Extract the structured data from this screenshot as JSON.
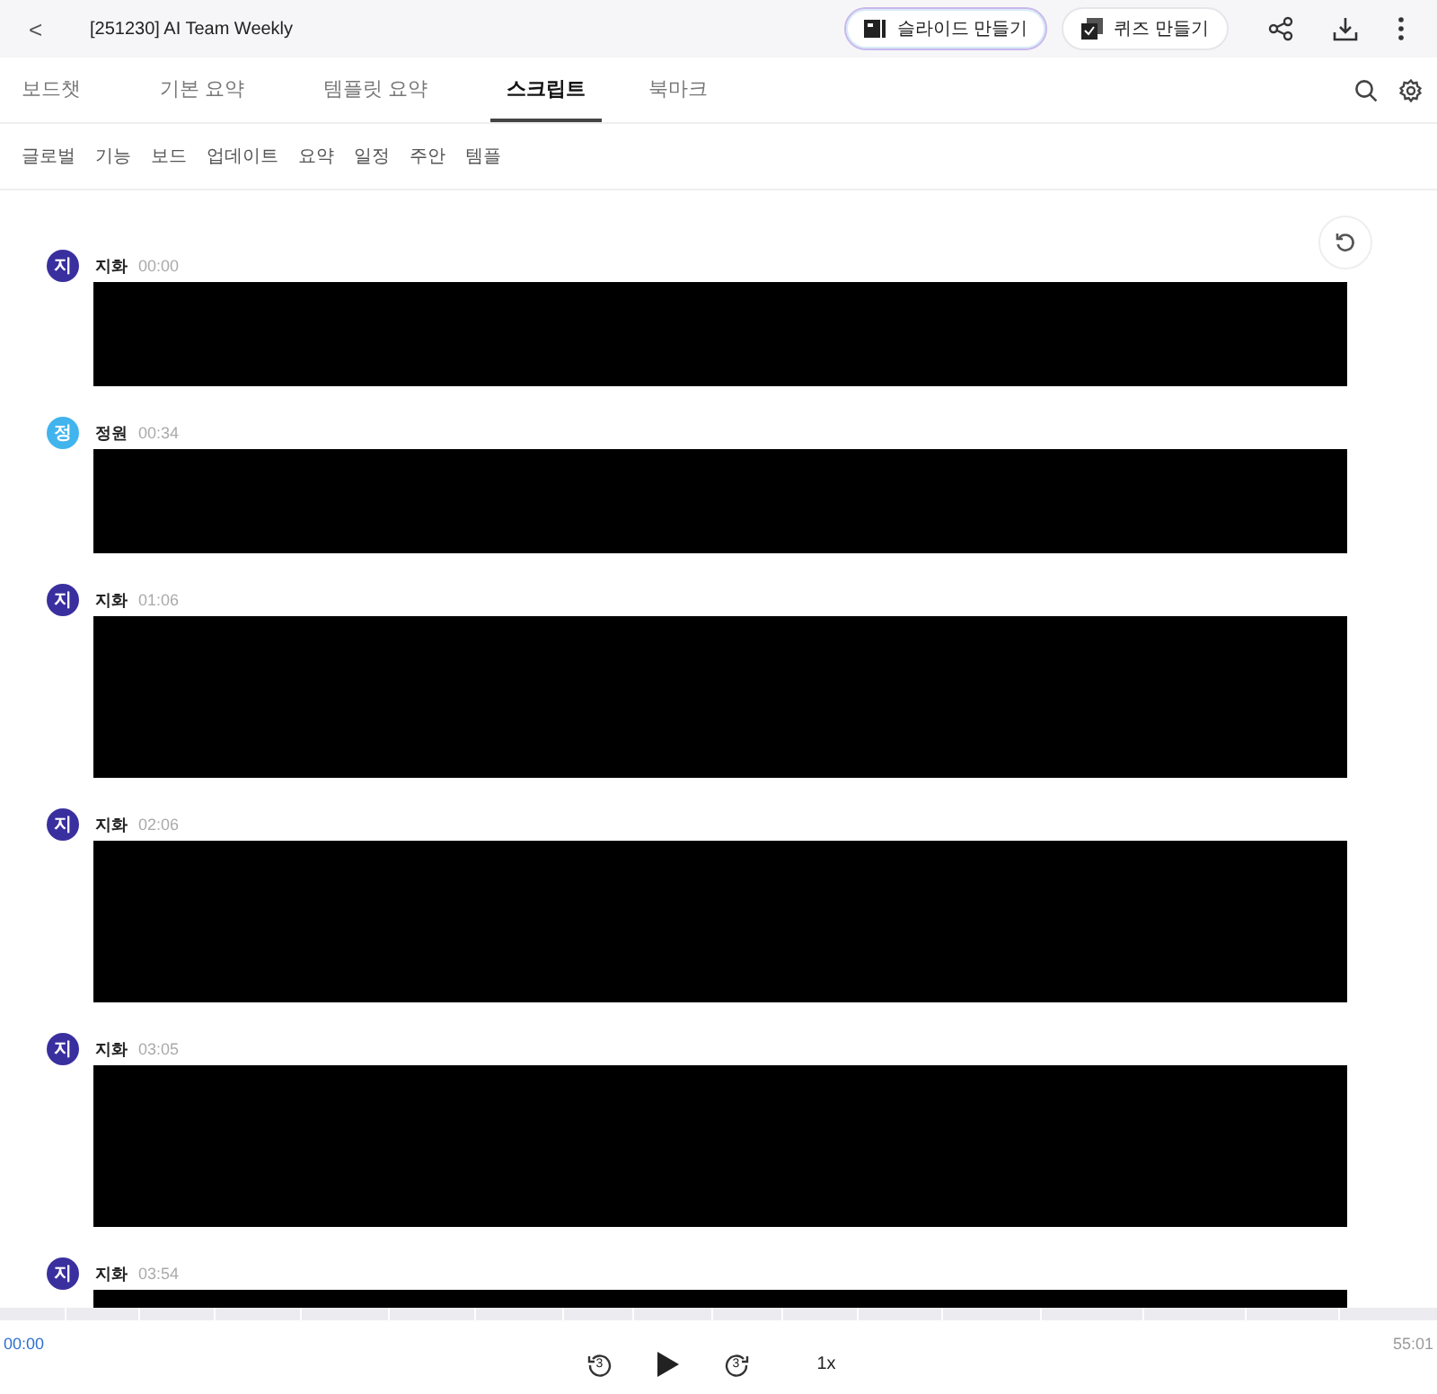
{
  "header": {
    "back": "<",
    "title": "[251230] AI Team Weekly",
    "buttons": [
      {
        "kind": "slides",
        "label": "슬라이드 만들기"
      },
      {
        "kind": "quiz",
        "label": "퀴즈 만들기"
      }
    ]
  },
  "tabs": [
    {
      "label": "보드챗",
      "selected": false
    },
    {
      "label": "기본 요약",
      "selected": false
    },
    {
      "label": "템플릿 요약",
      "selected": false
    },
    {
      "label": "스크립트",
      "selected": true
    },
    {
      "label": "북마크",
      "selected": false
    }
  ],
  "chips": [
    "글로벌",
    "기능",
    "보드",
    "업데이트",
    "요약",
    "일정",
    "주안",
    "템플"
  ],
  "entries": [
    {
      "initial": "지",
      "speaker": "지화",
      "time": "00:00",
      "color": "#3a2f9e"
    },
    {
      "initial": "정",
      "speaker": "정원",
      "time": "00:34",
      "color": "#41b4ee"
    },
    {
      "initial": "지",
      "speaker": "지화",
      "time": "01:06",
      "color": "#3a2f9e"
    },
    {
      "initial": "지",
      "speaker": "지화",
      "time": "02:06",
      "color": "#3a2f9e"
    },
    {
      "initial": "지",
      "speaker": "지화",
      "time": "03:05",
      "color": "#3a2f9e"
    },
    {
      "initial": "지",
      "speaker": "지화",
      "time": "03:54",
      "color": "#3a2f9e"
    }
  ],
  "player": {
    "current": "00:00",
    "total": "55:01",
    "speed": "1x",
    "back_seconds": "3",
    "forward_seconds": "3"
  }
}
